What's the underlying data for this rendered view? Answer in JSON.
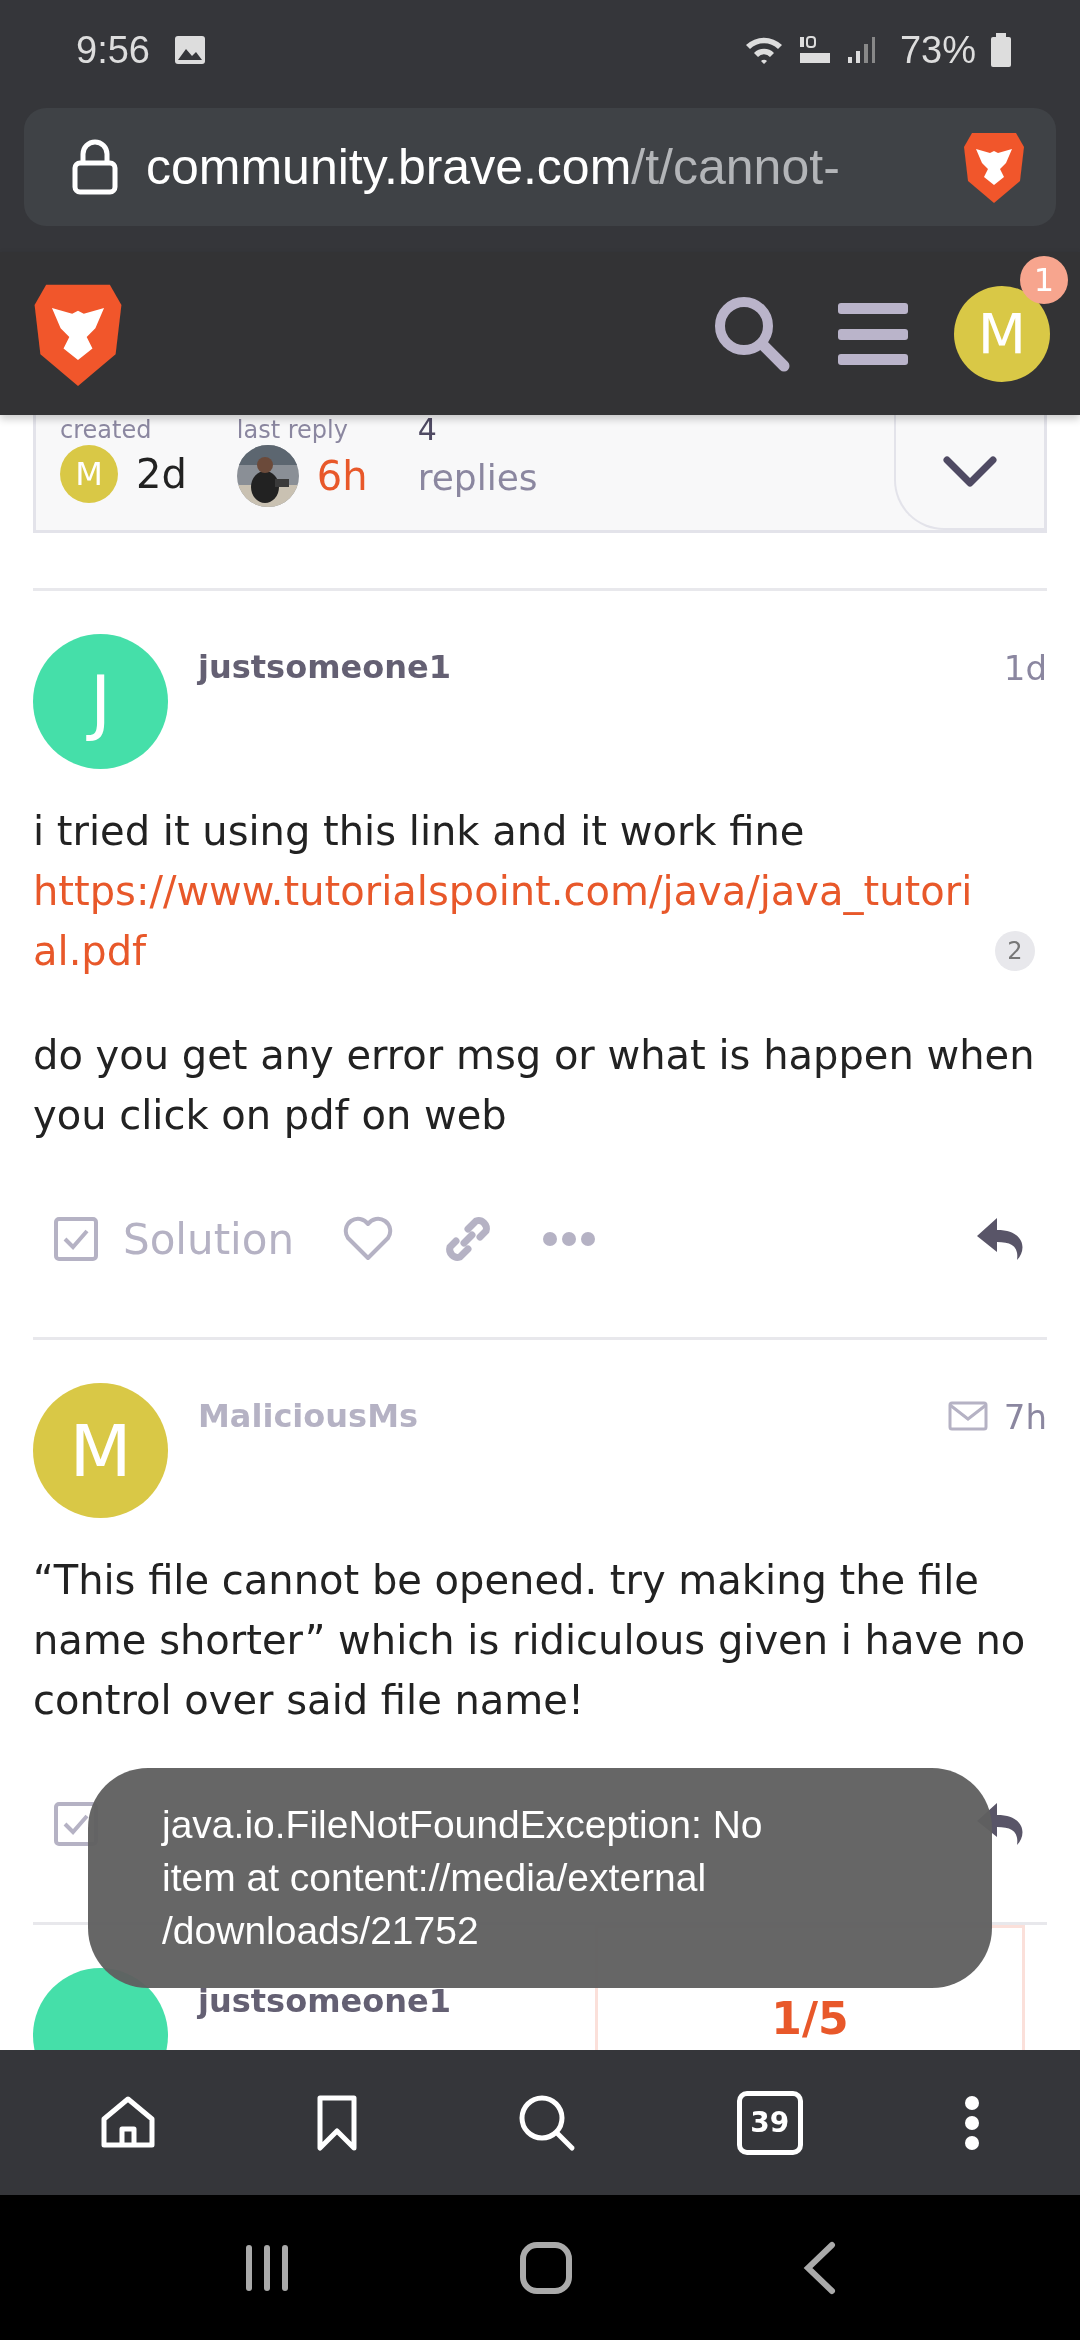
{
  "status_bar": {
    "time": "9:56",
    "battery": "73%"
  },
  "address_bar": {
    "domain": "community.brave.com",
    "path": "/t/cannot-"
  },
  "header": {
    "notification_count": "1",
    "user_initial": "M"
  },
  "topic_meta": {
    "created_label": "created",
    "created_avatar": "M",
    "created_time": "2d",
    "last_reply_label": "last reply",
    "last_reply_time": "6h",
    "replies_count": "4",
    "replies_label": "replies"
  },
  "posts": [
    {
      "username": "justsomeone1",
      "avatar_letter": "J",
      "color": "#45dfa9",
      "time": "1d",
      "mail": false,
      "body": [
        {
          "kind": "link_paragraph",
          "text": "i tried it using this link and it work fine",
          "link": "https://www.tutorialspoint.com/java/java_tutorial.pdf",
          "link_count": "2"
        },
        {
          "kind": "paragraph",
          "text": "do you get any error msg or what is happen when you click on pdf on web"
        }
      ],
      "actions": {
        "solution_label": "Solution"
      }
    },
    {
      "username": "MaliciousMs",
      "avatar_letter": "M",
      "color": "#d9c846",
      "time": "7h",
      "mail": true,
      "body": [
        {
          "kind": "paragraph",
          "text": "“This file cannot be opened. try making the file name shorter” which is ridiculous given i have no control over said file name!"
        }
      ]
    },
    {
      "username": "justsomeone1",
      "color": "#45dfa9",
      "mail": false
    }
  ],
  "timeline": {
    "position": "1/5"
  },
  "toast": {
    "text": "java.io.FileNotFoundException: No\nitem at content://media/external\n/downloads/21752"
  },
  "bottom_nav": {
    "tab_count": "39"
  }
}
